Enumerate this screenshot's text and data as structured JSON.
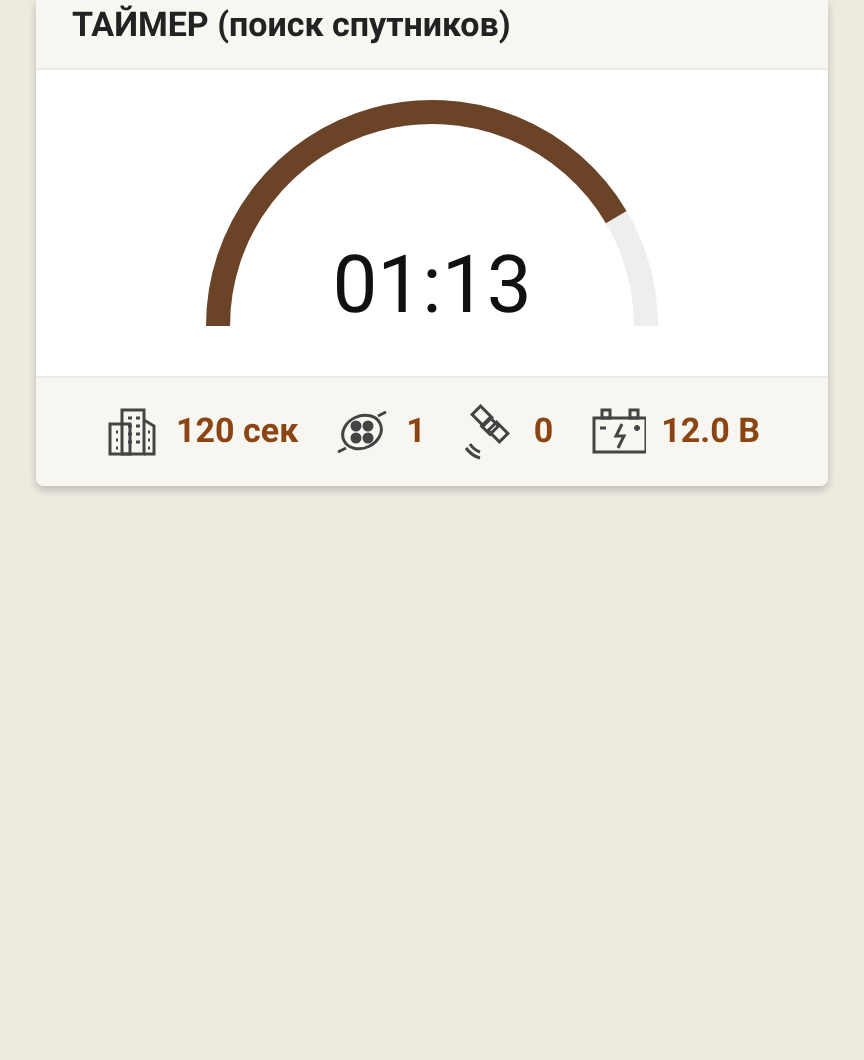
{
  "card": {
    "title": "ТАЙМЕР (поиск спутников)"
  },
  "gauge": {
    "reading": "01:13"
  },
  "stats": [
    {
      "kind": "building",
      "value": "120 сек"
    },
    {
      "kind": "drone",
      "value": "1"
    },
    {
      "kind": "satellite",
      "value": "0"
    },
    {
      "kind": "battery",
      "value": "12.0 В"
    }
  ]
}
